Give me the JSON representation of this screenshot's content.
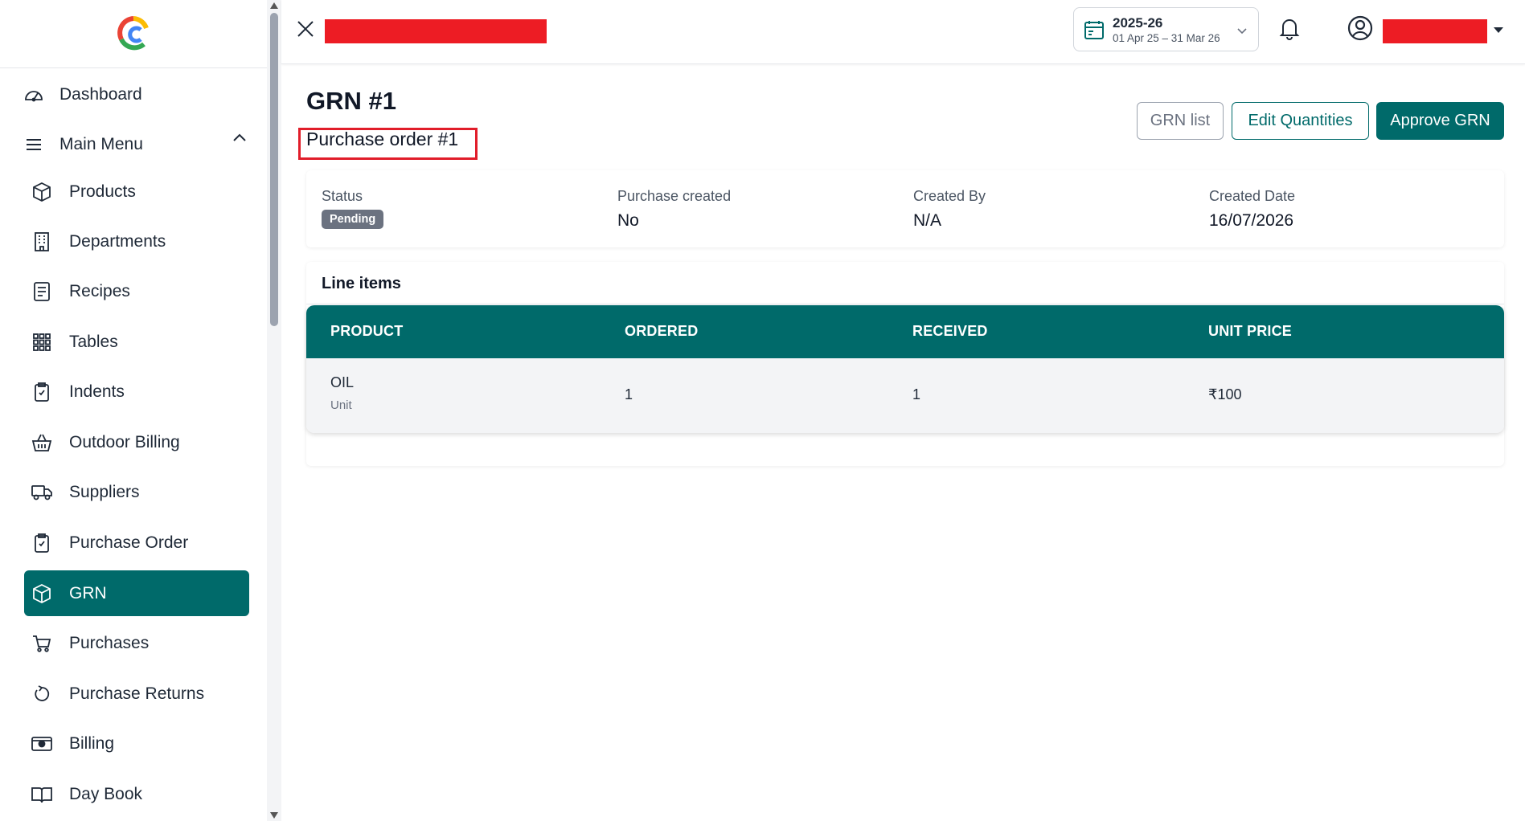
{
  "sidebar": {
    "dashboard_label": "Dashboard",
    "main_menu_label": "Main Menu",
    "items": [
      {
        "label": "Products"
      },
      {
        "label": "Departments"
      },
      {
        "label": "Recipes"
      },
      {
        "label": "Tables"
      },
      {
        "label": "Indents"
      },
      {
        "label": "Outdoor Billing"
      },
      {
        "label": "Suppliers"
      },
      {
        "label": "Purchase Order"
      },
      {
        "label": "GRN"
      },
      {
        "label": "Purchases"
      },
      {
        "label": "Purchase Returns"
      },
      {
        "label": "Billing"
      },
      {
        "label": "Day Book"
      }
    ],
    "active_item": "GRN"
  },
  "header": {
    "fiscal_year": "2025-26",
    "fiscal_range": "01 Apr 25 – 31 Mar 26"
  },
  "page": {
    "title": "GRN #1",
    "subtitle": "Purchase order #1",
    "buttons": {
      "grn_list": "GRN list",
      "edit_quantities": "Edit Quantities",
      "approve": "Approve GRN"
    },
    "info": {
      "status_label": "Status",
      "status_value": "Pending",
      "purchase_created_label": "Purchase created",
      "purchase_created_value": "No",
      "created_by_label": "Created By",
      "created_by_value": "N/A",
      "created_date_label": "Created Date",
      "created_date_value": "16/07/2026"
    },
    "line_items": {
      "title": "Line items",
      "columns": [
        "PRODUCT",
        "ORDERED",
        "RECEIVED",
        "UNIT PRICE"
      ],
      "rows": [
        {
          "product": "OIL",
          "unit": "Unit",
          "ordered": "1",
          "received": "1",
          "unit_price": "₹100"
        }
      ]
    }
  },
  "colors": {
    "accent": "#006a6a",
    "redaction": "#ed1c24",
    "highlight_box": "#e11d2a",
    "badge": "#6b7280"
  }
}
